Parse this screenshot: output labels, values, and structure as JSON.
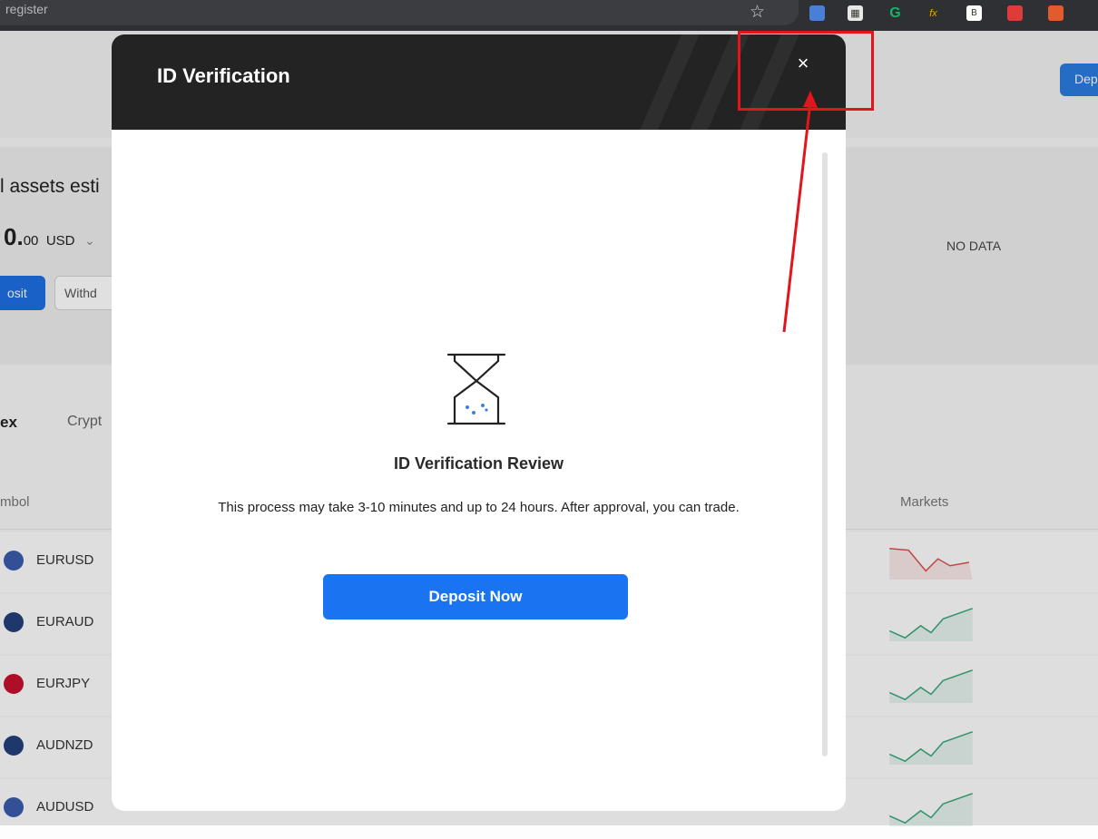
{
  "browser": {
    "url_fragment": "register",
    "star_icon": "bookmark-star-icon"
  },
  "background": {
    "top_deposit_label": "Dep",
    "assets_label": "l assets esti",
    "balance_main": "0.",
    "balance_cents": "00",
    "balance_currency": "USD",
    "currency_chevron": "⌄",
    "deposit_label": "osit",
    "withdraw_label": "Withd",
    "no_data": "NO DATA",
    "tabs": [
      "ex",
      "Crypt"
    ],
    "col_symbol": "mbol",
    "col_markets": "Markets",
    "rows": [
      {
        "symbol": "EURUSD",
        "trend": "down"
      },
      {
        "symbol": "EURAUD",
        "trend": "up"
      },
      {
        "symbol": "EURJPY",
        "trend": "up"
      },
      {
        "symbol": "AUDNZD",
        "trend": "up"
      },
      {
        "symbol": "AUDUSD",
        "trend": "up"
      }
    ],
    "colors": {
      "up": "#3aa77a",
      "down": "#d9534f"
    }
  },
  "modal": {
    "title": "ID Verification",
    "close_glyph": "×",
    "review_title": "ID Verification Review",
    "review_desc": "This process may take 3-10 minutes and up to 24 hours. After approval, you can trade.",
    "deposit_button": "Deposit Now",
    "icon": "hourglass-icon",
    "accent": "#1a73f0"
  },
  "annotation": {
    "color": "#e3141b"
  }
}
